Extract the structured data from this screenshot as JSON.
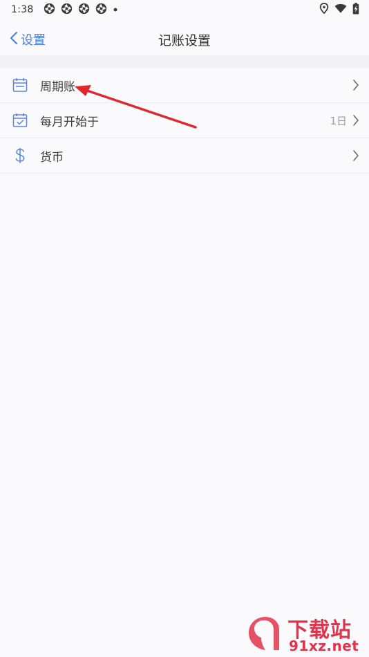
{
  "status_bar": {
    "time": "1:38",
    "left_icons": [
      "aperture-icon",
      "aperture-icon",
      "aperture-icon",
      "aperture-icon",
      "dot-icon"
    ],
    "right_icons": [
      "location-icon",
      "wifi-icon",
      "battery-charging-icon"
    ]
  },
  "nav": {
    "back_label": "设置",
    "title": "记账设置"
  },
  "settings": {
    "items": [
      {
        "label": "周期账",
        "icon": "calendar-icon",
        "value": ""
      },
      {
        "label": "每月开始于",
        "icon": "calendar-check-icon",
        "value": "1日"
      },
      {
        "label": "货币",
        "icon": "dollar-icon",
        "value": ""
      }
    ]
  },
  "watermark": {
    "text_cn": "下载站",
    "text_en": "91xz.net"
  },
  "colors": {
    "accent": "#4a7cf1",
    "background": "#fafafc",
    "band": "#f1f1f6",
    "annotation_arrow": "#e0262e",
    "watermark": "#e0344b"
  }
}
